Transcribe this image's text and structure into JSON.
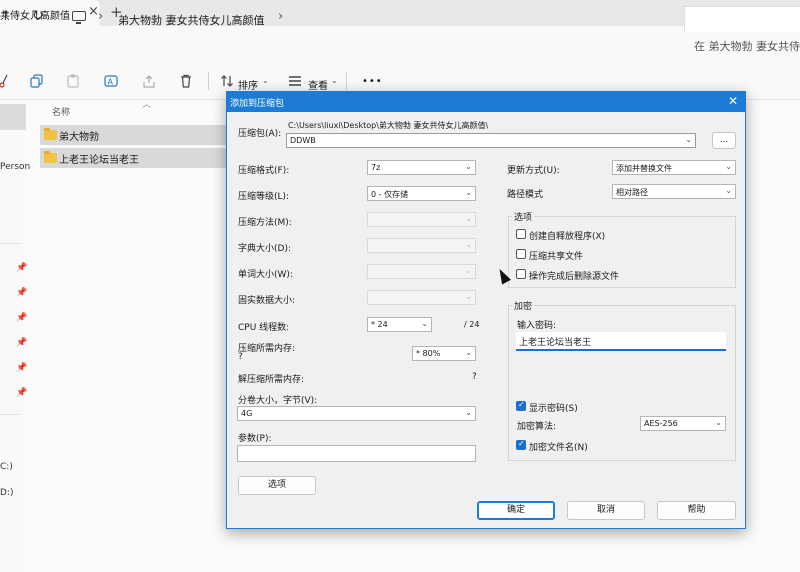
{
  "explorer": {
    "tab_title": "共侍女儿高颜值",
    "tab_close": "×",
    "tab_add": "+",
    "nav_up": "↑",
    "nav_refresh": "↻",
    "breadcrumb": "弟大物勃 妻女共侍女儿高颜值",
    "chevron": "›",
    "search_placeholder": "在 弟大物勃 妻女共侍",
    "toolbar": {
      "sort_label": "排序",
      "view_label": "查看",
      "more_label": "•••"
    },
    "column_name": "名称",
    "files": [
      "弟大物勃",
      "上老王论坛当老王"
    ],
    "left_pane": {
      "person_text": "Person",
      "drive_c": "C:)",
      "drive_d": "D:)"
    }
  },
  "dialog": {
    "title": "添加到压缩包",
    "close": "✕",
    "archive_label": "压缩包(A):",
    "archive_path": "C:\\Users\\liuxi\\Desktop\\弟大物勃 妻女共侍女儿高颜值\\",
    "archive_name": "DDWB",
    "browse_label": "...",
    "left": {
      "format_label": "压缩格式(F):",
      "format_value": "7z",
      "level_label": "压缩等级(L):",
      "level_value": "0 - 仅存储",
      "method_label": "压缩方法(M):",
      "dict_label": "字典大小(D):",
      "word_label": "单词大小(W):",
      "solid_label": "固实数据大小:",
      "threads_label": "CPU 线程数:",
      "threads_value": "* 24",
      "threads_total": "/ 24",
      "mem_comp_label": "压缩所需内存:",
      "mem_comp_q": "?",
      "mem_comp_value": "* 80%",
      "mem_decomp_label": "解压缩所需内存:",
      "mem_decomp_q": "?",
      "split_label": "分卷大小，字节(V):",
      "split_value": "4G",
      "params_label": "参数(P):",
      "options_button": "选项"
    },
    "right": {
      "update_label": "更新方式(U):",
      "update_value": "添加并替换文件",
      "path_label": "路径模式",
      "path_value": "相对路径",
      "options_group": "选项",
      "opt_sfx": "创建自释放程序(X)",
      "opt_shared": "压缩共享文件",
      "opt_delete": "操作完成后删除源文件",
      "enc_group": "加密",
      "password_label": "输入密码:",
      "password_value": "上老王论坛当老王",
      "show_password": "显示密码(S)",
      "enc_method_label": "加密算法:",
      "enc_method_value": "AES-256",
      "encrypt_names": "加密文件名(N)"
    },
    "buttons": {
      "ok": "确定",
      "cancel": "取消",
      "help": "帮助"
    }
  },
  "colors": {
    "accent": "#1c7cd5",
    "checkbox": "#1c6fcf",
    "folder": "#f2c343"
  }
}
